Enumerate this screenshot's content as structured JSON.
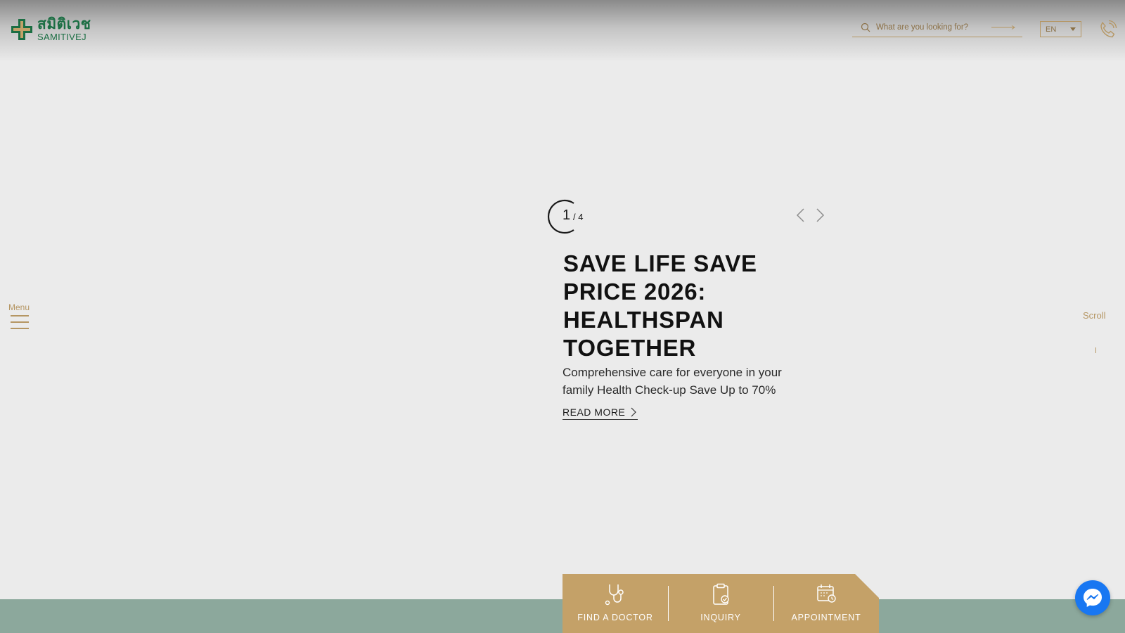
{
  "header": {
    "logo": {
      "thai_text": "สมิติเวช",
      "en_text": "SAMITIVEJ"
    },
    "search": {
      "placeholder": "What are you looking for?",
      "icon": "search-icon"
    },
    "language": {
      "selected": "EN"
    },
    "phone_icon": "phone-icon"
  },
  "sidebar": {
    "menu_label": "Menu",
    "scroll_label": "Scroll"
  },
  "hero": {
    "slide_current": "1",
    "slide_total": "/ 4",
    "title": "SAVE LIFE SAVE PRICE 2026: HEALTHSPAN TOGETHER",
    "subtitle": "Comprehensive care for everyone in your family Health Check-up Save Up to 70%",
    "read_more": "READ MORE"
  },
  "quick_actions": [
    {
      "label": "FIND A DOCTOR",
      "icon": "stethoscope-icon"
    },
    {
      "label": "INQUIRY",
      "icon": "clipboard-check-icon"
    },
    {
      "label": "APPOINTMENT",
      "icon": "calendar-clock-icon"
    }
  ],
  "colors": {
    "brand_green": "#1b6e43",
    "gold": "#c4a168",
    "gold_text": "#b59663",
    "footer_green": "#8ca89c",
    "messenger_blue": "#1877f2"
  }
}
